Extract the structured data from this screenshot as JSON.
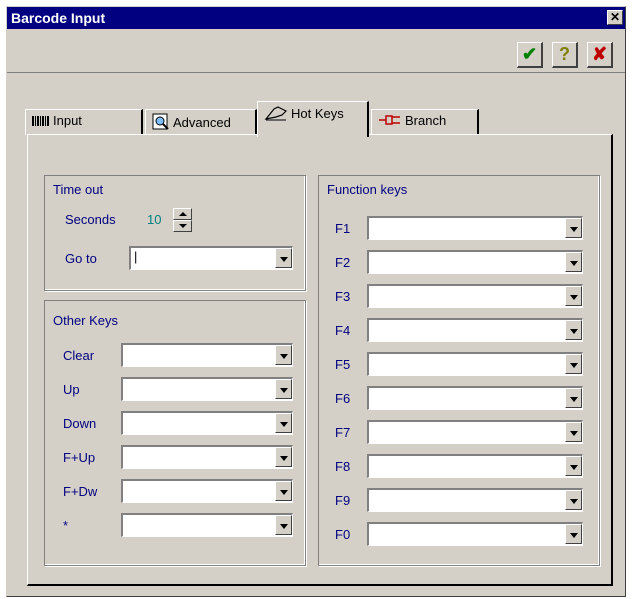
{
  "window": {
    "title": "Barcode Input",
    "close_glyph": "✕"
  },
  "toolbar": {
    "ok_glyph": "✔",
    "help_glyph": "?",
    "cancel_glyph": "✘",
    "ok_color": "#008000",
    "help_color": "#808000",
    "cancel_color": "#c00000"
  },
  "tabs": [
    {
      "label": "Input",
      "icon": "barcode-icon"
    },
    {
      "label": "Advanced",
      "icon": "magnifier-icon"
    },
    {
      "label": "Hot Keys",
      "icon": "hand-icon",
      "active": true
    },
    {
      "label": "Branch",
      "icon": "branch-icon"
    }
  ],
  "timeout": {
    "title": "Time out",
    "seconds_label": "Seconds",
    "seconds_value": "10",
    "goto_label": "Go to",
    "goto_value": ""
  },
  "other_keys": {
    "title": "Other Keys",
    "rows": [
      {
        "label": "Clear",
        "value": ""
      },
      {
        "label": "Up",
        "value": ""
      },
      {
        "label": "Down",
        "value": ""
      },
      {
        "label": "F+Up",
        "value": ""
      },
      {
        "label": "F+Dw",
        "value": ""
      },
      {
        "label": "*",
        "value": ""
      }
    ]
  },
  "function_keys": {
    "title": "Function keys",
    "rows": [
      {
        "label": "F1",
        "value": ""
      },
      {
        "label": "F2",
        "value": ""
      },
      {
        "label": "F3",
        "value": ""
      },
      {
        "label": "F4",
        "value": ""
      },
      {
        "label": "F5",
        "value": ""
      },
      {
        "label": "F6",
        "value": ""
      },
      {
        "label": "F7",
        "value": ""
      },
      {
        "label": "F8",
        "value": ""
      },
      {
        "label": "F9",
        "value": ""
      },
      {
        "label": "F0",
        "value": ""
      }
    ]
  },
  "colors": {
    "title_bar": "#000080",
    "face": "#d4d0c8",
    "label_text": "#000080",
    "seconds_value": "#008080"
  }
}
